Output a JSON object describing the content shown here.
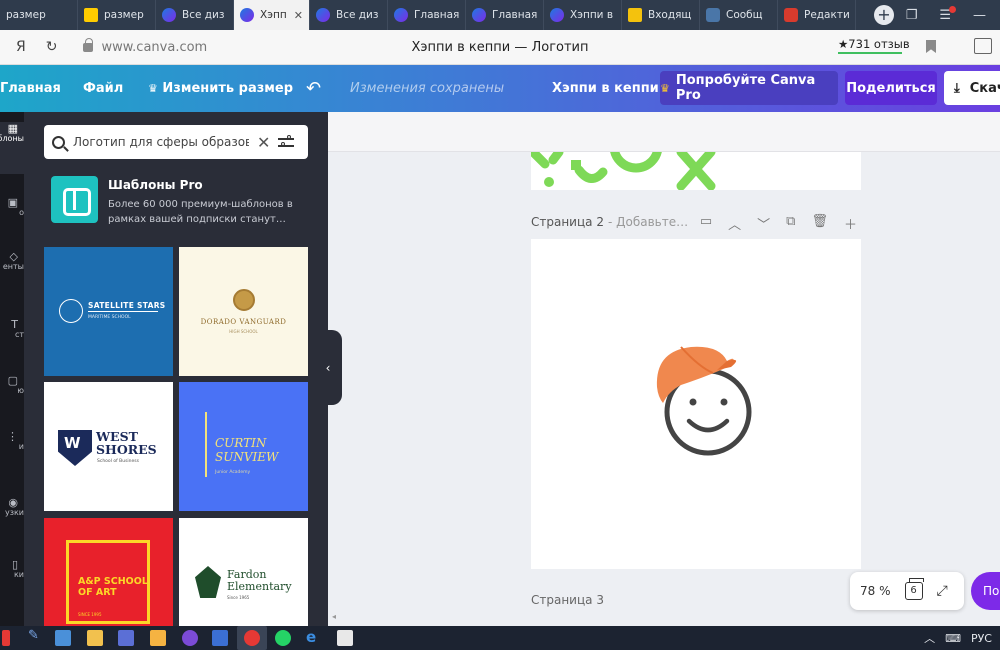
{
  "browser": {
    "tabs": [
      {
        "label": "размер",
        "icon": "generic-tab-icon",
        "active": false
      },
      {
        "label": "размер",
        "icon": "yandex-icon",
        "active": false
      },
      {
        "label": "Все диз",
        "icon": "canva-icon",
        "active": false
      },
      {
        "label": "Хэпп",
        "icon": "canva-icon",
        "active": true
      },
      {
        "label": "Все диз",
        "icon": "canva-icon",
        "active": false
      },
      {
        "label": "Главная",
        "icon": "canva-icon",
        "active": false
      },
      {
        "label": "Главная",
        "icon": "canva-icon",
        "active": false
      },
      {
        "label": "Хэппи в",
        "icon": "canva-icon",
        "active": false
      },
      {
        "label": "Входящ",
        "icon": "mail-icon",
        "active": false
      },
      {
        "label": "Сообщ",
        "icon": "vk-icon",
        "active": false
      },
      {
        "label": "Редакти",
        "icon": "red-icon",
        "active": false
      }
    ],
    "yandex_letter": "Я",
    "url": "www.canva.com",
    "page_title": "Хэппи в кеппи — Логотип",
    "reviews": "★731 отзыв"
  },
  "header": {
    "home": "Главная",
    "file": "Файл",
    "resize": "Изменить размер",
    "saved_status": "Изменения сохранены",
    "design_name": "Хэппи в кеппи",
    "try_pro": "Попробуйте Canva Pro",
    "share": "Поделиться",
    "download": "Скач"
  },
  "rail": {
    "items": [
      {
        "label": "аблоны",
        "icon": "templates-icon"
      },
      {
        "label": "о",
        "icon": "photos-icon"
      },
      {
        "label": "енты",
        "icon": "elements-icon"
      },
      {
        "label": "ст",
        "icon": "text-icon"
      },
      {
        "label": "ю",
        "icon": "video-icon"
      },
      {
        "label": "и",
        "icon": "bg-icon"
      },
      {
        "label": "узки",
        "icon": "uploads-icon"
      },
      {
        "label": "ки",
        "icon": "folders-icon"
      }
    ]
  },
  "panel": {
    "search_value": "Логотип для сферы образова",
    "pro_title": "Шаблоны Pro",
    "pro_desc": "Более 60 000 премиум-шаблонов в рамках вашей подписки станут…",
    "templates": [
      {
        "name": "SATELLITE STARS",
        "sub": "MARITIME SCHOOL"
      },
      {
        "name": "DORADO VANGUARD",
        "sub": "HIGH SCHOOL"
      },
      {
        "name": "WEST SHORES",
        "sub": "School of Business"
      },
      {
        "name": "CURTIN SUNVIEW",
        "sub": "Junior Academy"
      },
      {
        "name": "A&P SCHOOL OF ART",
        "sub": "SINCE 1995"
      },
      {
        "name": "Fardon Elementary",
        "sub": "Since 1965"
      }
    ]
  },
  "editor": {
    "page2_title": "Страница 2",
    "page2_hint": "- Добавьте…",
    "page3_title": "Страница 3",
    "zoom": "78 %",
    "page_count": "6",
    "help": "По"
  },
  "taskbar": {
    "language": "РУС"
  },
  "colors": {
    "brand_start": "#1ea6c9",
    "brand_end": "#6a3fe0",
    "panel_bg": "#2a2d38",
    "cap_orange": "#f0884e",
    "pattern_green": "#7ed957"
  }
}
